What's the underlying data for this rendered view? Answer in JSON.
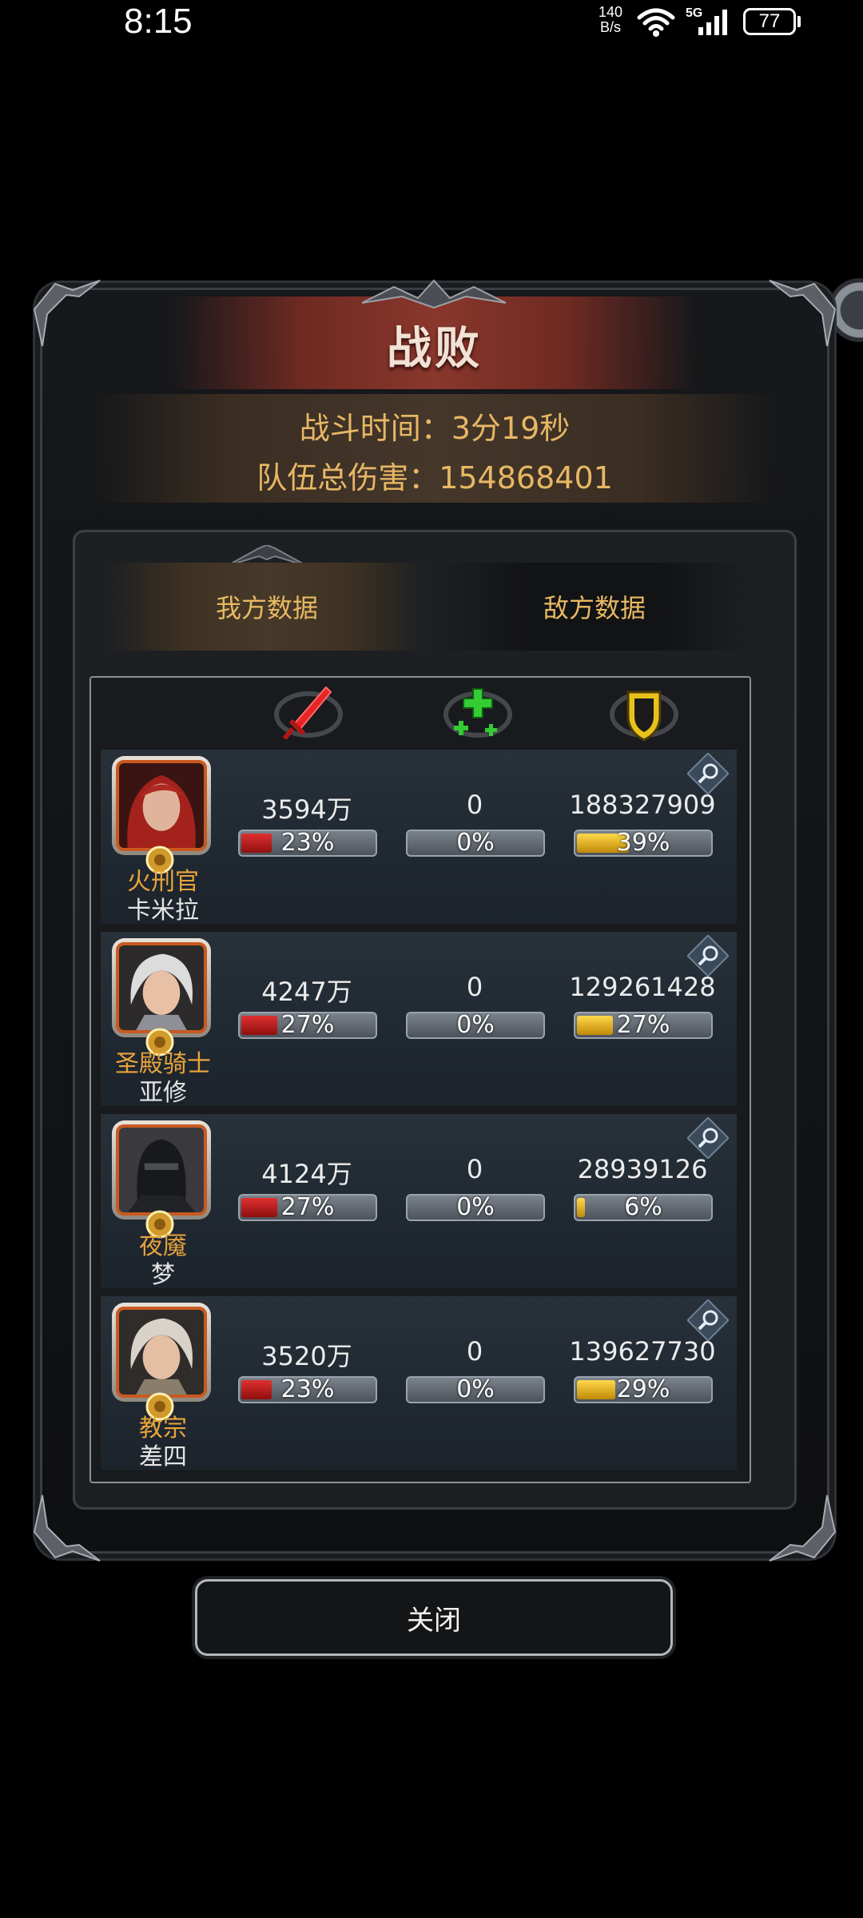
{
  "status_bar": {
    "time": "8:15",
    "net_speed_value": "140",
    "net_speed_unit": "B/s",
    "network_type": "5G",
    "battery": "77"
  },
  "dialog": {
    "title": "战败",
    "battle_time": "战斗时间：3分19秒",
    "total_damage": "队伍总伤害：154868401",
    "tabs": [
      {
        "label": "我方数据",
        "selected": true
      },
      {
        "label": "敌方数据",
        "selected": false
      }
    ],
    "column_icons": [
      "sword-icon",
      "heal-plus-icon",
      "shield-icon"
    ],
    "heroes": [
      {
        "class": "火刑官",
        "name": "卡米拉",
        "damage": "3594万",
        "damage_pct": "23%",
        "damage_ratio": 0.23,
        "heal": "0",
        "heal_pct": "0%",
        "heal_ratio": 0,
        "tank": "188327909",
        "tank_pct": "39%",
        "tank_ratio": 0.39
      },
      {
        "class": "圣殿骑士",
        "name": "亚修",
        "damage": "4247万",
        "damage_pct": "27%",
        "damage_ratio": 0.27,
        "heal": "0",
        "heal_pct": "0%",
        "heal_ratio": 0,
        "tank": "129261428",
        "tank_pct": "27%",
        "tank_ratio": 0.27
      },
      {
        "class": "夜魇",
        "name": "梦",
        "damage": "4124万",
        "damage_pct": "27%",
        "damage_ratio": 0.27,
        "heal": "0",
        "heal_pct": "0%",
        "heal_ratio": 0,
        "tank": "28939126",
        "tank_pct": "6%",
        "tank_ratio": 0.06
      },
      {
        "class": "教宗",
        "name": "差四",
        "damage": "3520万",
        "damage_pct": "23%",
        "damage_ratio": 0.23,
        "heal": "0",
        "heal_pct": "0%",
        "heal_ratio": 0,
        "tank": "139627730",
        "tank_pct": "29%",
        "tank_ratio": 0.29
      }
    ],
    "close_label": "关闭"
  },
  "colors": {
    "title_banner": "#8a372c",
    "info_text": "#e7b765",
    "damage_bar": "#e03030",
    "tank_bar": "#ffd84a",
    "heal_icon": "#33cc33"
  }
}
